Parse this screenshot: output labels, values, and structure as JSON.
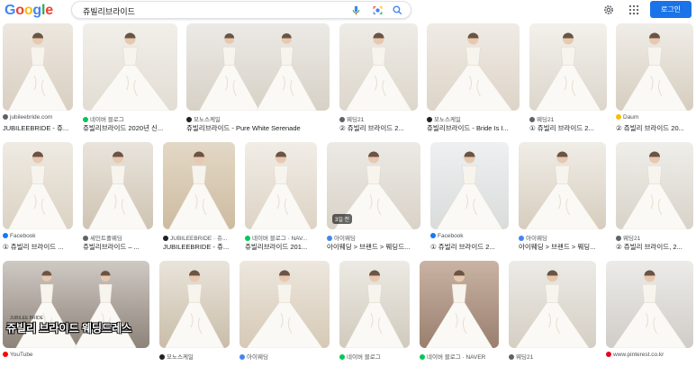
{
  "header": {
    "logo": [
      "G",
      "o",
      "o",
      "g",
      "l",
      "e"
    ],
    "logo_colors": [
      "#4285f4",
      "#ea4335",
      "#fbbc05",
      "#4285f4",
      "#34a853",
      "#ea4335"
    ],
    "search_value": "쥬빌리브라이드",
    "login_label": "로그인"
  },
  "results": [
    {
      "src": "jubileebride.com",
      "cap": "JUBILEEBRIDE - 쥬...",
      "dot": "#5f6368"
    },
    {
      "src": "네이버 블로그",
      "cap": "쥬빌리브라이드 2020년 신...",
      "dot": "#03c75a"
    },
    {
      "src": "모노스케일",
      "cap": "쥬빌리브라이드 - Pure White Serenade",
      "dot": "#202124"
    },
    {
      "src": "웨딩21",
      "cap": "② 쥬빌리 브라이드 2...",
      "dot": "#5f6368"
    },
    {
      "src": "모노스케일",
      "cap": "쥬빌리브라이드 - Bride Is I...",
      "dot": "#202124"
    },
    {
      "src": "웨딩21",
      "cap": "① 쥬빌리 브라이드 2...",
      "dot": "#5f6368"
    },
    {
      "src": "Daum",
      "cap": "② 쥬빌리 브라이드 20...",
      "dot": "#fbbc05"
    },
    {
      "src": "Facebook",
      "cap": "① 쥬빌리 브라이드 ...",
      "dot": "#1877f2"
    },
    {
      "src": "세인트폴웨딩",
      "cap": "쥬빌리브라이드 – ...",
      "dot": "#5f6368"
    },
    {
      "src": "JUBILEEBRIDE · 쥬...",
      "cap": "JUBILEEBRIDE - 쥬...",
      "dot": "#202124"
    },
    {
      "src": "네이버 블로그 · NAV...",
      "cap": "쥬빌리브라이드 201...",
      "dot": "#03c75a"
    },
    {
      "src": "아이웨딩",
      "cap": "아이웨딩 > 브랜드 > 웨딩드...",
      "dot": "#4285f4",
      "badge": "3일 전"
    },
    {
      "src": "Facebook",
      "cap": "① 쥬빌리 브라이드 2...",
      "dot": "#1877f2"
    },
    {
      "src": "아이웨딩",
      "cap": "아이웨딩 > 브랜드 > 웨딩...",
      "dot": "#4285f4"
    },
    {
      "src": "웨딩21",
      "cap": "② 쥬빌리 브라이드, 2...",
      "dot": "#5f6368"
    },
    {
      "src": "YouTube",
      "cap": "",
      "dot": "#ff0000",
      "overlay": "쥬빌리 브라이드 웨딩드레스",
      "overlay_brand": "JUBILEE BRIDE"
    },
    {
      "src": "모노스케일",
      "cap": "",
      "dot": "#202124"
    },
    {
      "src": "아이웨딩",
      "cap": "",
      "dot": "#4285f4"
    },
    {
      "src": "네이버 블로그",
      "cap": "",
      "dot": "#03c75a"
    },
    {
      "src": "네이버 블로그 · NAVER",
      "cap": "",
      "dot": "#03c75a"
    },
    {
      "src": "웨딩21",
      "cap": "",
      "dot": "#5f6368"
    },
    {
      "src": "www.pinterest.co.kr",
      "cap": "",
      "dot": "#e60023"
    }
  ]
}
